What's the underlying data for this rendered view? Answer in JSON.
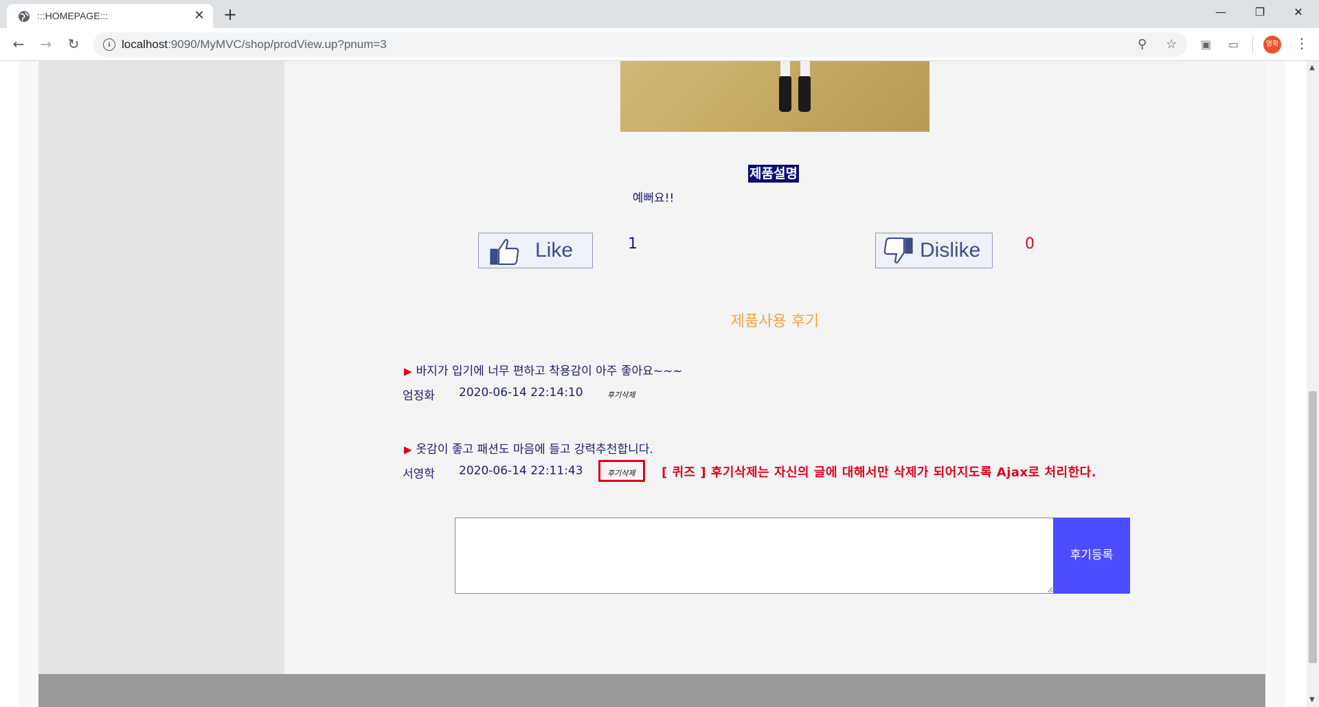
{
  "browser": {
    "tab_title": ":::HOMEPAGE:::",
    "url_host": "localhost",
    "url_rest": ":9090/MyMVC/shop/prodView.up?pnum=3",
    "profile_initials": "영학"
  },
  "product": {
    "description_heading": "제품설명",
    "description_text": "예뻐요!!"
  },
  "likes": {
    "like_label": "Like",
    "like_count": "1",
    "dislike_label": "Dislike",
    "dislike_count": "0",
    "like_count_color": "#1c1c6e",
    "dislike_count_color": "#e0001a"
  },
  "reviews": {
    "section_title": "제품사용 후기",
    "items": [
      {
        "text": "바지가 입기에 너무 편하고 착용감이 아주 좋아요~~~",
        "author": "엄정화",
        "date": "2020-06-14 22:14:10",
        "delete_label": "후기삭제"
      },
      {
        "text": "옷감이 좋고 패션도 마음에 들고 강력추천합니다.",
        "author": "서영학",
        "date": "2020-06-14 22:11:43",
        "delete_label": "후기삭제"
      }
    ],
    "quiz_note": "[ 퀴즈 ] 후기삭제는 자신의 글에 대해서만 삭제가 되어지도록 Ajax로 처리한다.",
    "submit_label": "후기등록",
    "input_value": ""
  }
}
